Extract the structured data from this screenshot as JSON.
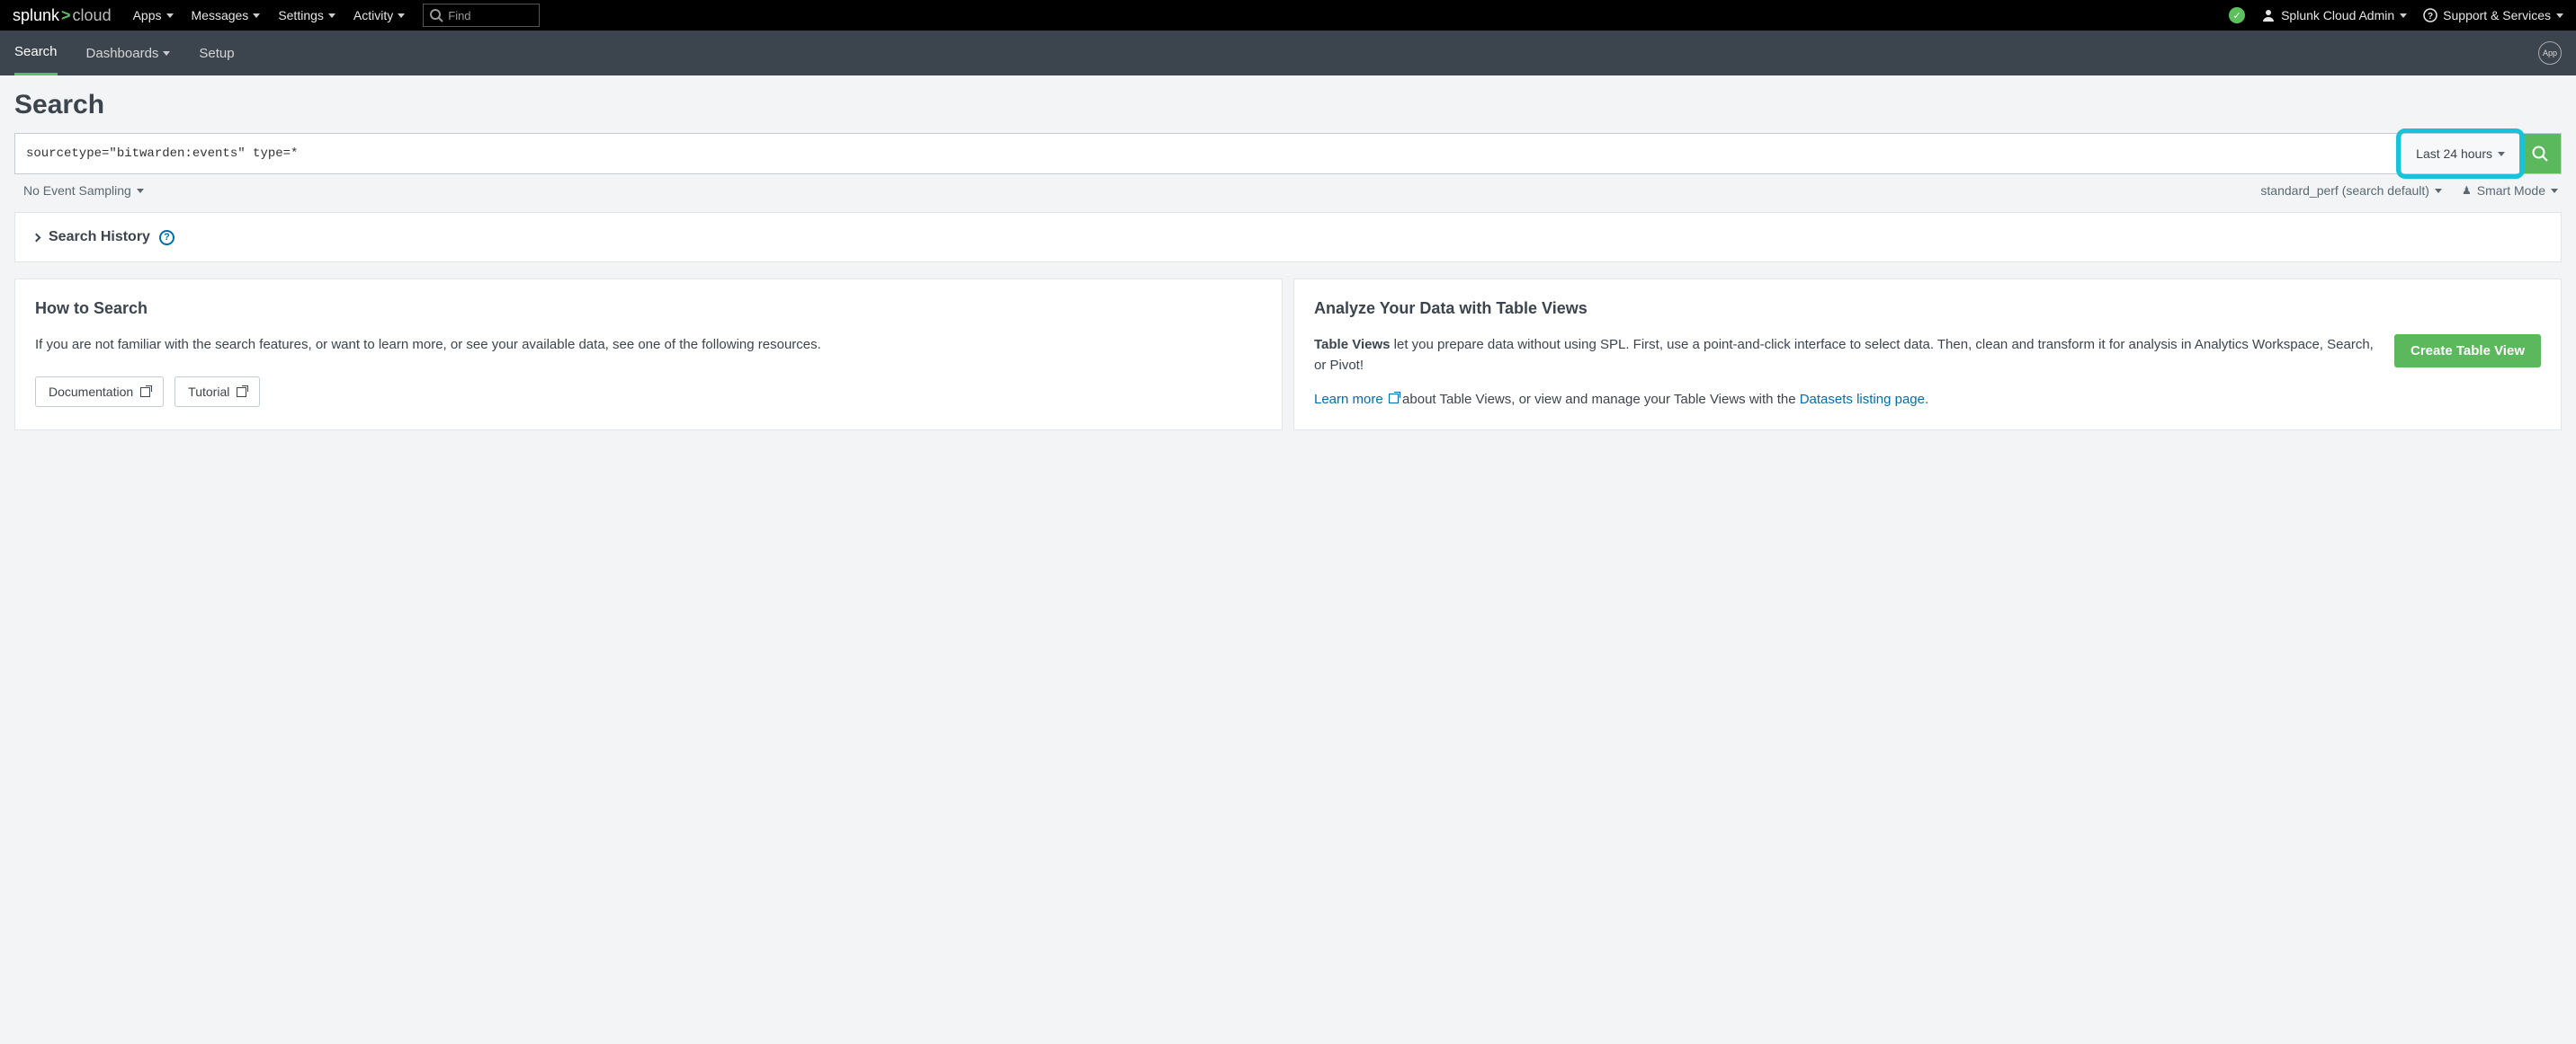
{
  "top": {
    "logo_main": "splunk",
    "logo_cloud": "cloud",
    "menu": [
      "Apps",
      "Messages",
      "Settings",
      "Activity"
    ],
    "find_placeholder": "Find",
    "user": "Splunk Cloud Admin",
    "support": "Support & Services"
  },
  "sub": {
    "tabs": [
      "Search",
      "Dashboards",
      "Setup"
    ],
    "app_badge": "App"
  },
  "page_title": "Search",
  "search": {
    "query": "sourcetype=\"bitwarden:events\" type=*",
    "time_label": "Last 24 hours"
  },
  "below": {
    "sampling": "No Event Sampling",
    "workload": "standard_perf (search default)",
    "mode": "Smart Mode"
  },
  "history": {
    "label": "Search History"
  },
  "card_left": {
    "title": "How to Search",
    "body": "If you are not familiar with the search features, or want to learn more, or see your available data, see one of the following resources.",
    "btn_doc": "Documentation",
    "btn_tut": "Tutorial"
  },
  "card_right": {
    "title": "Analyze Your Data with Table Views",
    "body_strong": "Table Views",
    "body_rest": " let you prepare data without using SPL. First, use a point-and-click interface to select data. Then, clean and transform it for analysis in Analytics Workspace, Search, or Pivot!",
    "learn_more": "Learn more",
    "about_rest": " about Table Views, or view and manage your Table Views with the ",
    "datasets_link": "Datasets listing page.",
    "btn": "Create Table View"
  }
}
